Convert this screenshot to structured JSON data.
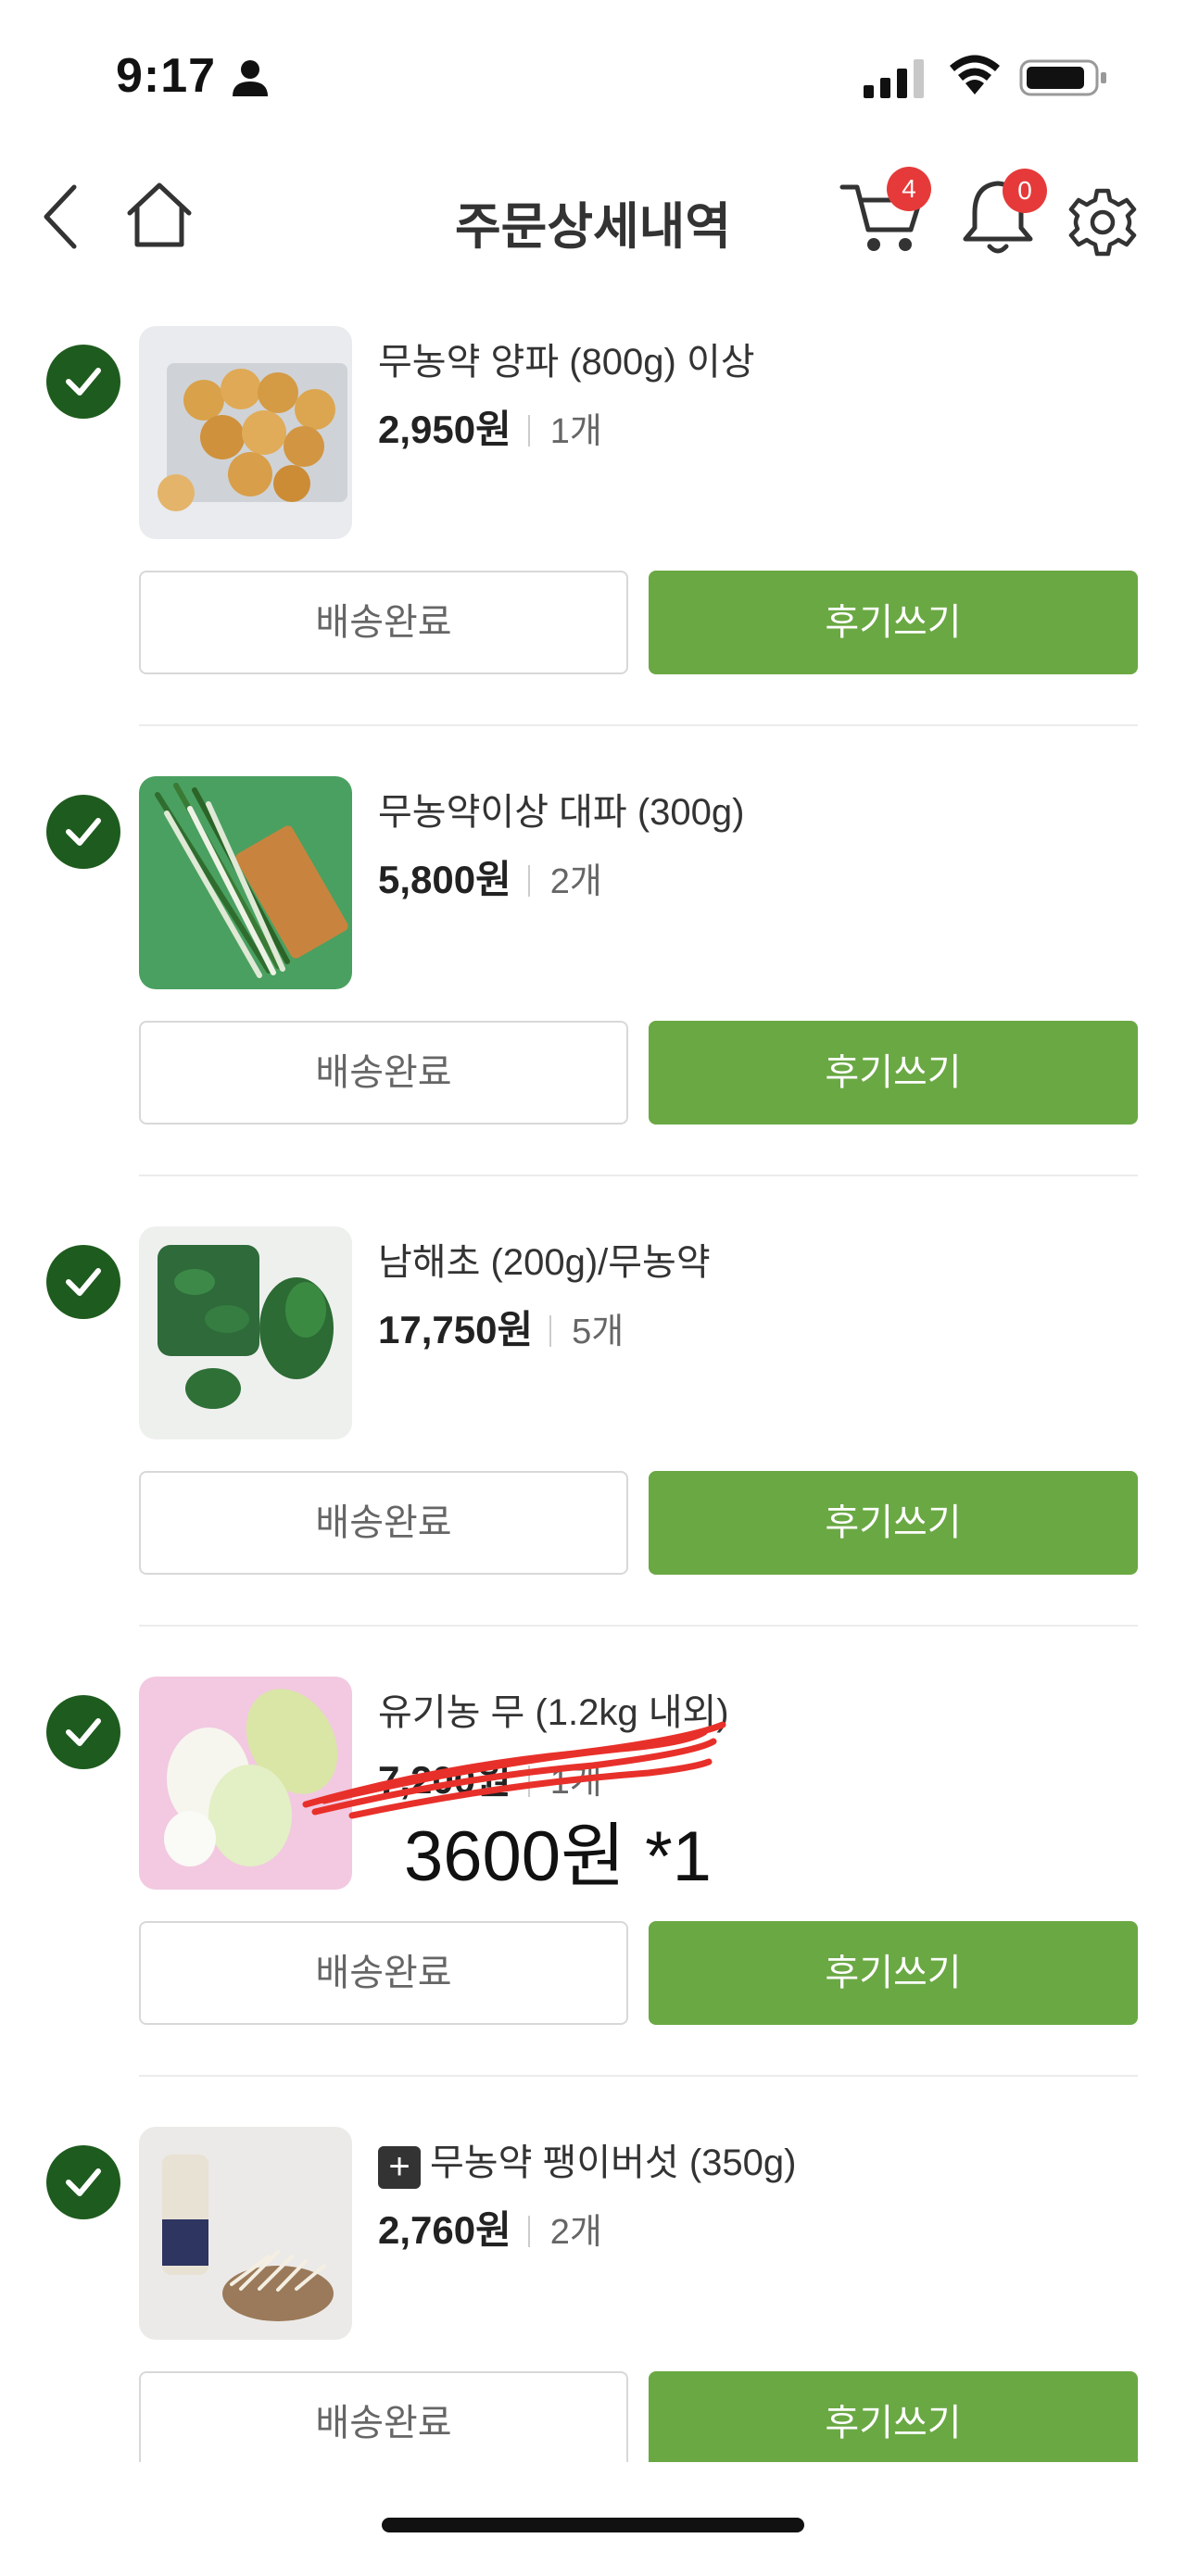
{
  "status_bar": {
    "time": "9:17"
  },
  "header": {
    "title": "주문상세내역",
    "cart_count": "4",
    "notification_count": "0"
  },
  "items": [
    {
      "name": "무농약 양파 (800g) 이상",
      "price": "2,950원",
      "qty": "1개",
      "status_label": "배송완료",
      "review_label": "후기쓰기"
    },
    {
      "name": "무농약이상 대파 (300g)",
      "price": "5,800원",
      "qty": "2개",
      "status_label": "배송완료",
      "review_label": "후기쓰기"
    },
    {
      "name": "남해초 (200g)/무농약",
      "price": "17,750원",
      "qty": "5개",
      "status_label": "배송완료",
      "review_label": "후기쓰기"
    },
    {
      "name": "유기농 무 (1.2kg 내외)",
      "price": "7,200원",
      "qty": "1개",
      "status_label": "배송완료",
      "review_label": "후기쓰기",
      "handwritten_note": "3600원 *1"
    },
    {
      "name": "무농약 팽이버섯 (350g)",
      "price": "2,760원",
      "qty": "2개",
      "status_label": "배송완료",
      "review_label": "후기쓰기",
      "tag": "+"
    }
  ],
  "colors": {
    "accent": "#6aa843",
    "check": "#1e5b1e",
    "badge": "#e63a3a"
  },
  "icons": [
    "person-icon",
    "signal-icon",
    "wifi-icon",
    "battery-icon",
    "back-icon",
    "home-icon",
    "cart-icon",
    "bell-icon",
    "gear-icon",
    "check-icon"
  ]
}
